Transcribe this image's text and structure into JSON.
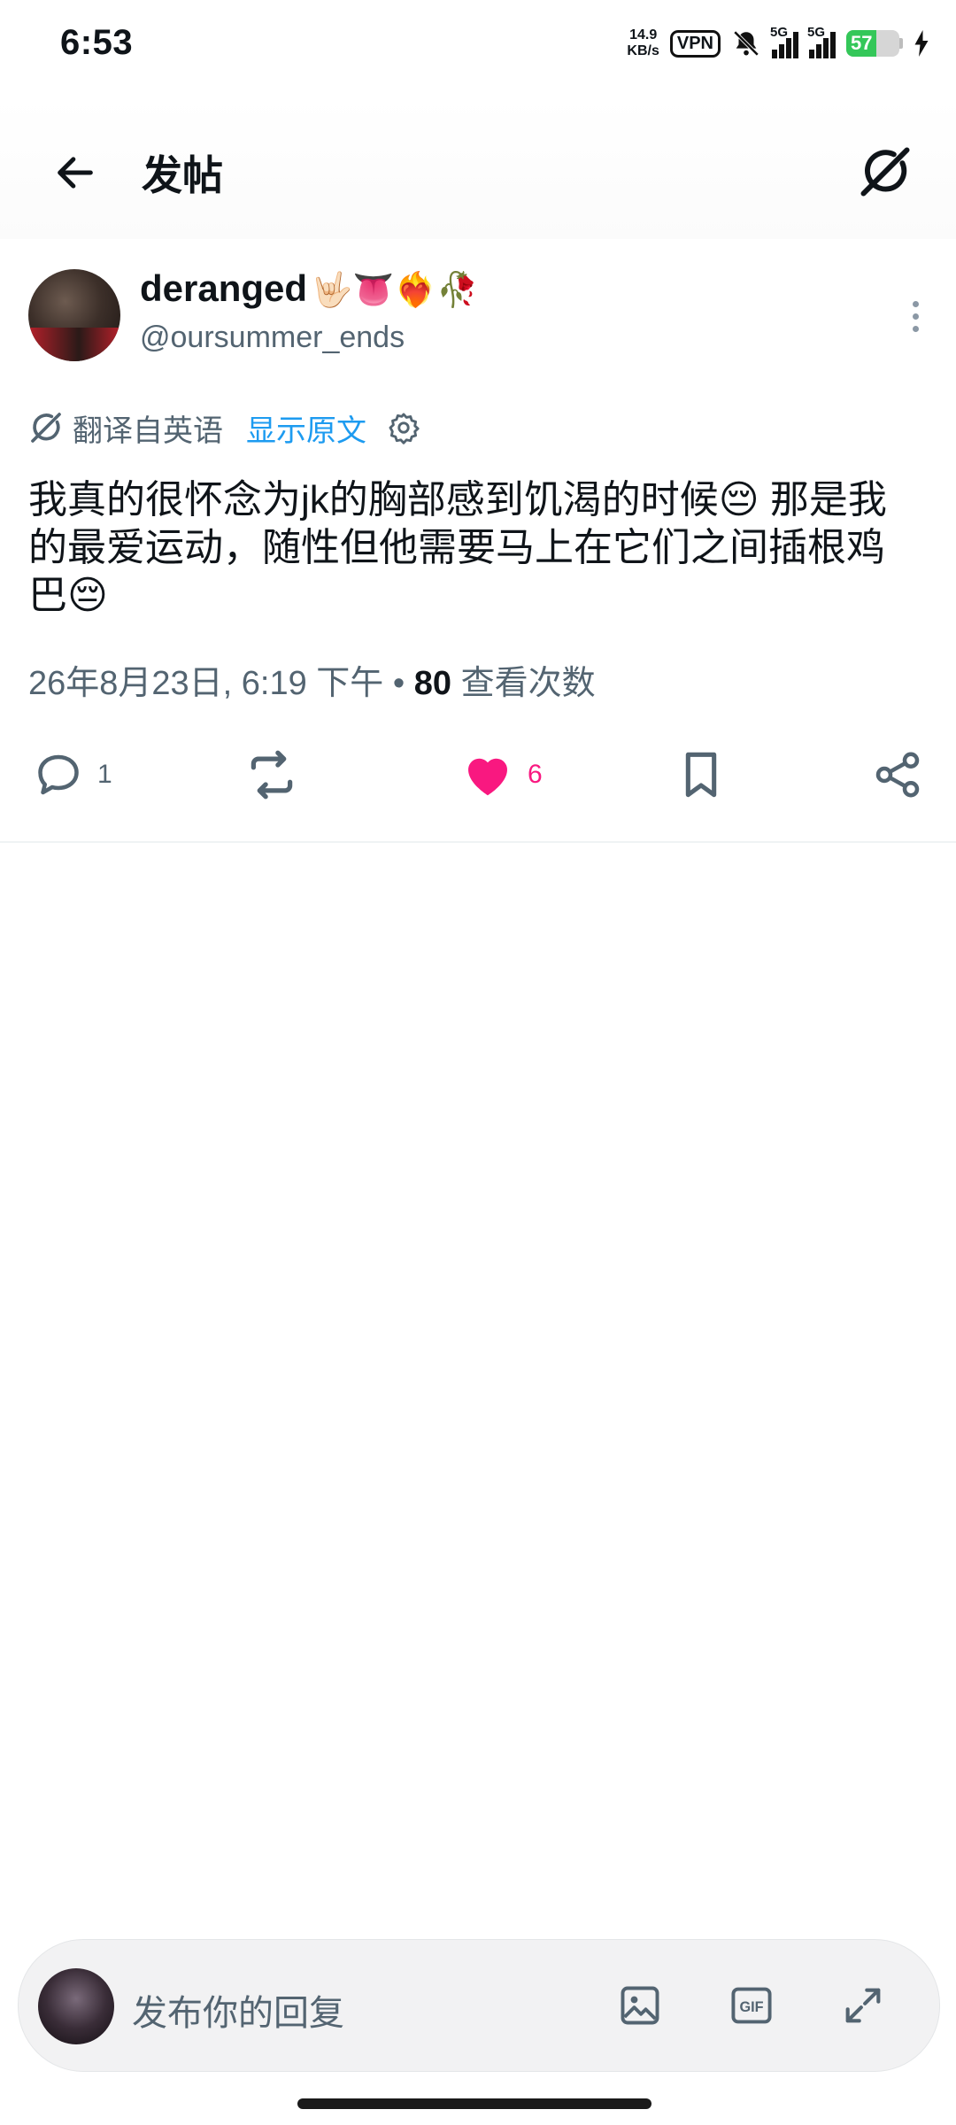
{
  "status_bar": {
    "time": "6:53",
    "net_speed_value": "14.9",
    "net_speed_unit": "KB/s",
    "vpn": "VPN",
    "signal1_label": "5G",
    "signal2_label": "5G",
    "battery": "57",
    "battery_level": 0.57
  },
  "header": {
    "title": "发帖"
  },
  "post": {
    "author": {
      "display_name": "deranged",
      "name_emojis": "🤟🏻👅❤️‍🔥🥀",
      "handle": "@oursummer_ends"
    },
    "translation": {
      "label": "翻译自英语",
      "show_original": "显示原文"
    },
    "text": "我真的很怀念为jk的胸部感到饥渴的时候😔 那是我的最爱运动，随性但他需要马上在它们之间插根鸡巴😔",
    "timestamp": "26年8月23日, 6:19 下午",
    "separator": "•",
    "views_count": "80",
    "views_label": "查看次数",
    "actions": {
      "reply_count": "1",
      "like_count": "6",
      "like_color": "#f91880"
    }
  },
  "reply_bar": {
    "placeholder": "发布你的回复"
  }
}
